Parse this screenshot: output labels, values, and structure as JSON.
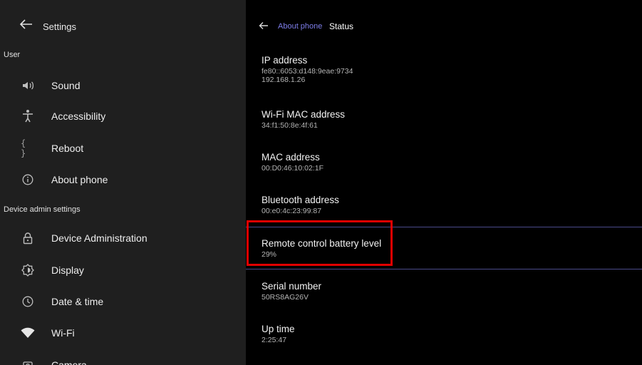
{
  "left": {
    "title": "Settings",
    "sections": [
      "User",
      "Device admin settings"
    ],
    "items": [
      {
        "label": "Sound",
        "icon": "volume-icon"
      },
      {
        "label": "Accessibility",
        "icon": "accessibility-icon"
      },
      {
        "label": "Reboot",
        "icon": "braces-icon"
      },
      {
        "label": "About phone",
        "icon": "info-icon"
      },
      {
        "label": "Device Administration",
        "icon": "lock-icon"
      },
      {
        "label": "Display",
        "icon": "brightness-icon"
      },
      {
        "label": "Date & time",
        "icon": "clock-icon"
      },
      {
        "label": "Wi-Fi",
        "icon": "wifi-icon"
      },
      {
        "label": "Camera",
        "icon": "camera-icon"
      }
    ]
  },
  "right": {
    "breadcrumb": "About phone",
    "title": "Status",
    "rows": [
      {
        "title": "IP address",
        "value": "fe80::6053:d148:9eae:9734\n192.168.1.26"
      },
      {
        "title": "Wi-Fi MAC address",
        "value": "34:f1:50:8e:4f:61"
      },
      {
        "title": "MAC address",
        "value": "00:D0:46:10:02:1F"
      },
      {
        "title": "Bluetooth address",
        "value": "00:e0:4c:23:99:87"
      },
      {
        "title": "Remote control battery level",
        "value": "29%"
      },
      {
        "title": "Serial number",
        "value": "50RS8AG26V"
      },
      {
        "title": "Up time",
        "value": "2:25:47"
      }
    ]
  },
  "colors": {
    "left_bg": "#1f1f1f",
    "right_bg": "#000000",
    "accent": "#7d7de8",
    "highlight": "#e00000"
  }
}
